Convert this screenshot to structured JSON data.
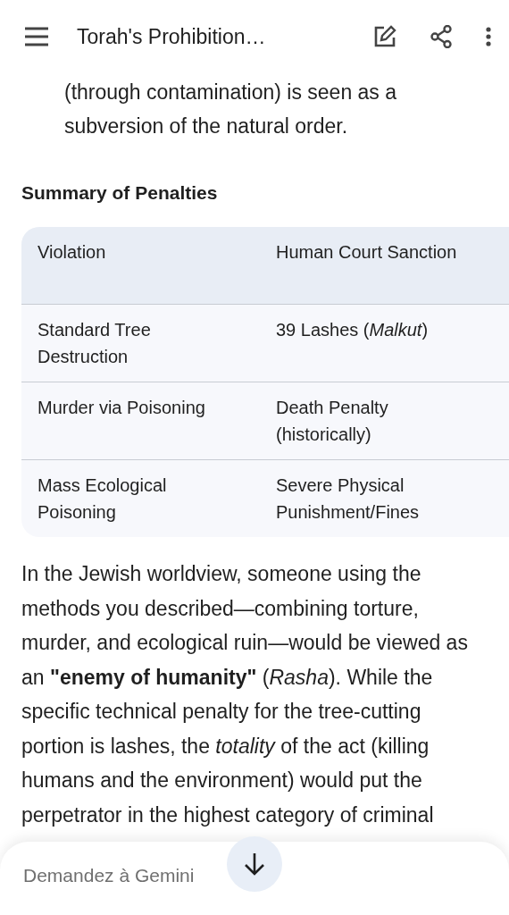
{
  "top_bar": {
    "title": "Torah's Prohibition…"
  },
  "intro_text": "(through contamination) is seen as a subversion of the natural order.",
  "section_heading": "Summary of Penalties",
  "table": {
    "columns": [
      "Violation",
      "Human Court Sanction"
    ],
    "rows": [
      [
        "Standard Tree Destruction",
        "39 Lashes (*Malkut*)"
      ],
      [
        "Murder via Poisoning",
        "Death Penalty (historically)"
      ],
      [
        "Mass Ecological Poisoning",
        "Severe Physical Punishment/Fines"
      ]
    ]
  },
  "paragraph": "In the Jewish worldview, someone using the methods you described—combining torture, murder, and ecological ruin—would be viewed as an **\"enemy of humanity\"** (*Rasha*). While the specific technical penalty for the tree-cutting portion is lashes, the *totality* of the act (killing humans and the environment) would put the perpetrator in the highest category of criminal",
  "prompt_field": {
    "placeholder": "Demandez à Gemini"
  }
}
